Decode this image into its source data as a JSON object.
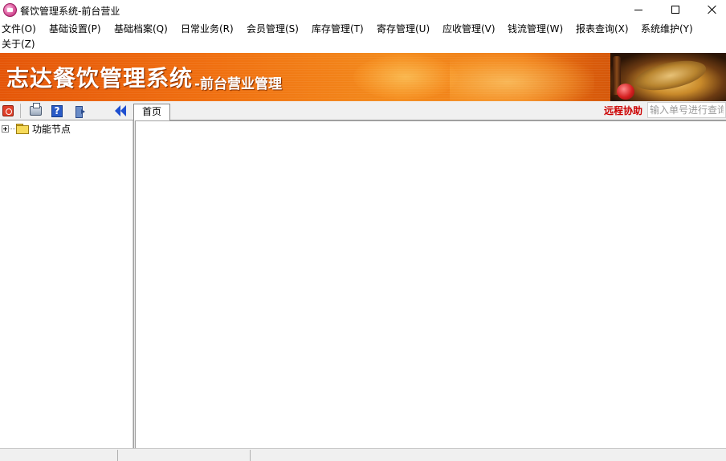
{
  "window": {
    "title": "餐饮管理系统-前台营业",
    "icon": "app-logo-icon"
  },
  "menu": [
    {
      "label": "文件(O)"
    },
    {
      "label": "基础设置(P)"
    },
    {
      "label": "基础档案(Q)"
    },
    {
      "label": "日常业务(R)"
    },
    {
      "label": "会员管理(S)"
    },
    {
      "label": "库存管理(T)"
    },
    {
      "label": "寄存管理(U)"
    },
    {
      "label": "应收管理(V)"
    },
    {
      "label": "钱流管理(W)"
    },
    {
      "label": "报表查询(X)"
    },
    {
      "label": "系统维护(Y)"
    },
    {
      "label": "关于(Z)"
    }
  ],
  "banner": {
    "title": "志达餐饮管理系统",
    "subtitle": "-前台营业管理"
  },
  "toolbar": {
    "buttons": [
      "stop-icon",
      "print-icon",
      "help-icon",
      "exit-icon",
      "collapse-panel-icon"
    ]
  },
  "tabs": [
    {
      "label": "首页",
      "active": true
    }
  ],
  "header_right": {
    "remote_help": "远程协助",
    "search_placeholder": "输入单号进行查询"
  },
  "tree": {
    "root": {
      "label": "功能节点",
      "expanded": false
    }
  },
  "colors": {
    "banner_orange": "#f07010",
    "remote_help_red": "#cc0000"
  }
}
